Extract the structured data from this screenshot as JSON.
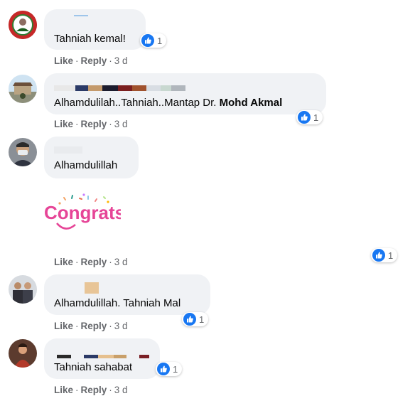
{
  "reaction_type": "like-icon",
  "comments": [
    {
      "avatar": "avatar-red-bg",
      "text": "Tahniah kemal!",
      "reaction_count": "1",
      "actions": {
        "like": "Like",
        "reply": "Reply",
        "age": "3 d"
      }
    },
    {
      "avatar": "avatar-outdoor",
      "text": "Alhamdulilah..Tahniah..Mantap Dr. ",
      "text_bold": "Mohd Akmal",
      "reaction_count": "1",
      "actions": {
        "like": "Like",
        "reply": "Reply",
        "age": "3 d"
      }
    },
    {
      "avatar": "avatar-masked-man",
      "text": "Alhamdulillah",
      "sticker_text": "Congrats!",
      "reaction_count": "1",
      "actions": {
        "like": "Like",
        "reply": "Reply",
        "age": "3 d"
      }
    },
    {
      "avatar": "avatar-group-photo",
      "text": "Alhamdulillah. Tahniah Mal",
      "reaction_count": "1",
      "actions": {
        "like": "Like",
        "reply": "Reply",
        "age": "3 d"
      }
    },
    {
      "avatar": "avatar-person-red",
      "text": "Tahniah sahabat",
      "reaction_count": "1",
      "actions": {
        "like": "Like",
        "reply": "Reply",
        "age": "3 d"
      }
    }
  ],
  "colors": {
    "bubble": "#f0f2f5",
    "meta_text": "#65676b",
    "like_blue": "#1877f2"
  }
}
